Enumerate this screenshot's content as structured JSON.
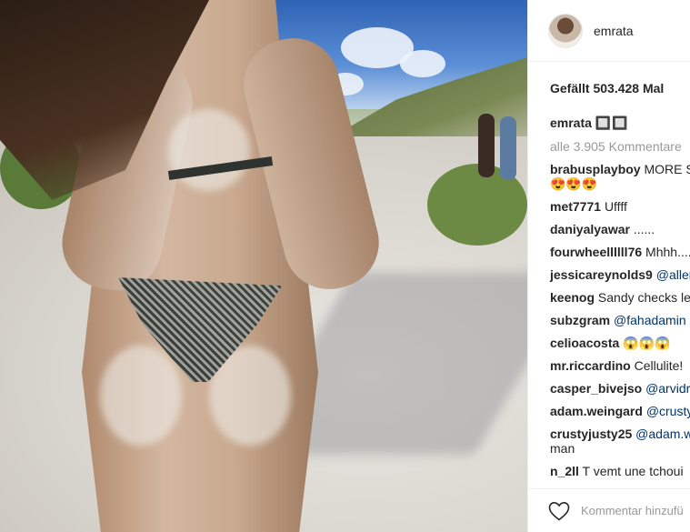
{
  "post": {
    "username": "emrata",
    "likes": "Gefällt 503.428 Mal",
    "caption_user": "emrata",
    "caption_text": "🔲🔲",
    "view_all": "alle 3.905 Kommentare",
    "add_comment_placeholder": "Kommentar hinzufü"
  },
  "comments": [
    {
      "user": "brabusplayboy",
      "text": "MORE S",
      "line2": "😍😍😍"
    },
    {
      "user": "met7771",
      "text": "Uffff"
    },
    {
      "user": "daniyalyawar",
      "text": "......"
    },
    {
      "user": "fourwheellllll76",
      "text": "Mhhh...."
    },
    {
      "user": "jessicareynolds9",
      "mention": "@aller"
    },
    {
      "user": "keenog",
      "text": "Sandy checks le"
    },
    {
      "user": "subzgram",
      "mention": "@fahadamin"
    },
    {
      "user": "celioacosta",
      "text": "😱😱😱"
    },
    {
      "user": "mr.riccardino",
      "text": "Cellulite!"
    },
    {
      "user": "casper_bivejso",
      "mention": "@arvidr"
    },
    {
      "user": "adam.weingard",
      "mention": "@crusty"
    },
    {
      "user": "crustyjusty25",
      "mention": "@adam.w",
      "line2": "man"
    },
    {
      "user": "n_2ll",
      "text": "T vemt une tchoui"
    }
  ],
  "colors": {
    "text": "#262626",
    "muted": "#999999",
    "link": "#003569",
    "border": "#efefef"
  },
  "icons": {
    "like": "heart-icon"
  }
}
